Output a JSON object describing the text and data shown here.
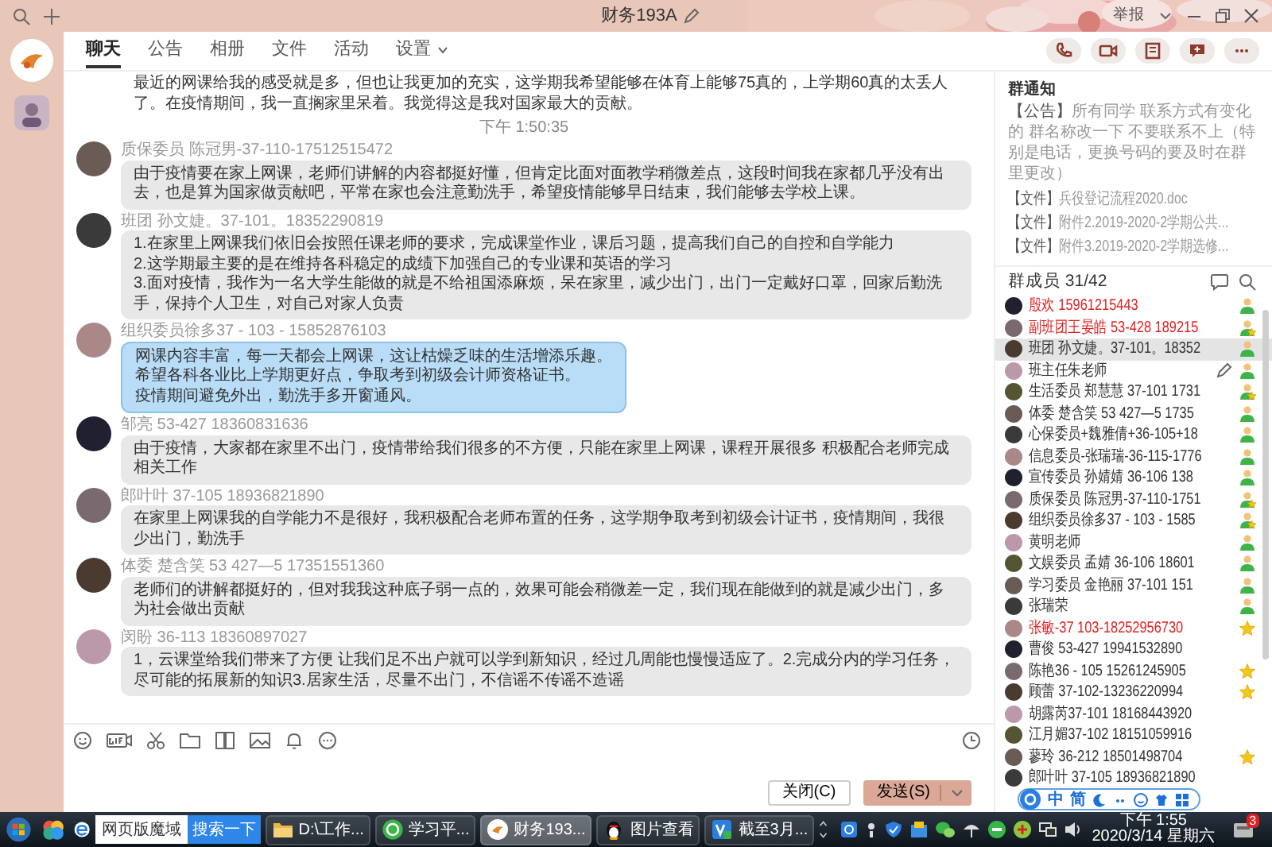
{
  "window": {
    "title": "财务193A",
    "report": "举报"
  },
  "tabs": [
    {
      "label": "聊天",
      "selected": true,
      "dropdown": false
    },
    {
      "label": "公告",
      "selected": false,
      "dropdown": false
    },
    {
      "label": "相册",
      "selected": false,
      "dropdown": false
    },
    {
      "label": "文件",
      "selected": false,
      "dropdown": false
    },
    {
      "label": "活动",
      "selected": false,
      "dropdown": false
    },
    {
      "label": "设置",
      "selected": false,
      "dropdown": true
    }
  ],
  "messages": [
    {
      "kind": "plain",
      "lines": [
        "最近的网课给我的感受就是多，但也让我更加的充实，这学期我希望能够在体育上能够75真的，上学期60真的太丢人了。在疫情期间，我一直搁家里呆着。我觉得这是我对国家最大的贡献。"
      ]
    },
    {
      "kind": "time",
      "text": "下午 1:50:35"
    },
    {
      "kind": "gray",
      "sender": "质保委员 陈冠男-37-110-17512515472",
      "lines": [
        "由于疫情要在家上网课，老师们讲解的内容都挺好懂，但肯定比面对面教学稍微差点，这段时间我在家都几乎没有出去，也是算为国家做贡献吧，平常在家也会注意勤洗手，希望疫情能够早日结束，我们能够去学校上课。"
      ]
    },
    {
      "kind": "gray",
      "sender": "班团 孙文婕。37-101。18352290819",
      "lines": [
        "1.在家里上网课我们依旧会按照任课老师的要求，完成课堂作业，课后习题，提高我们自己的自控和自学能力",
        "2.这学期最主要的是在维持各科稳定的成绩下加强自己的专业课和英语的学习",
        "3.面对疫情，我作为一名大学生能做的就是不给祖国添麻烦，呆在家里，减少出门，出门一定戴好口罩，回家后勤洗手，保持个人卫生，对自己对家人负责"
      ]
    },
    {
      "kind": "blue",
      "sender": "组织委员徐多37 - 103 - 15852876103",
      "lines": [
        "网课内容丰富，每一天都会上网课，这让枯燥乏味的生活增添乐趣。",
        "希望各科各业比上学期更好点，争取考到初级会计师资格证书。",
        "疫情期间避免外出，勤洗手多开窗通风。"
      ]
    },
    {
      "kind": "gray",
      "sender": "邹亮 53-427 18360831636",
      "lines": [
        "由于疫情，大家都在家里不出门，疫情带给我们很多的不方便，只能在家里上网课，课程开展很多 积极配合老师完成相关工作"
      ]
    },
    {
      "kind": "gray",
      "sender": "郎叶叶 37-105 18936821890",
      "lines": [
        "在家里上网课我的自学能力不是很好，我积极配合老师布置的任务，这学期争取考到初级会计证书，疫情期间，我很少出门，勤洗手"
      ]
    },
    {
      "kind": "gray",
      "sender": "体委 楚含笑 53 427—5 17351551360",
      "lines": [
        "老师们的讲解都挺好的，但对我我这种底子弱一点的，效果可能会稍微差一定，我们现在能做到的就是减少出门，多为社会做出贡献"
      ]
    },
    {
      "kind": "gray",
      "sender": "闵盼 36-113 18360897027",
      "lines": [
        "1，云课堂给我们带来了方便 让我们足不出户就可以学到新知识，经过几周能也慢慢适应了。2.完成分内的学习任务，尽可能的拓展新的知识3.居家生活，尽量不出门，不信谣不传谣不造谣"
      ]
    }
  ],
  "composer": {
    "close_button": "关闭(C)",
    "send_button": "发送(S)"
  },
  "notice": {
    "title": "群通知",
    "tag": "【公告】",
    "text": "所有同学 联系方式有变化的 群名称改一下 不要联系不上（特别是电话，更换号码的要及时在群里更改）",
    "files": [
      {
        "tag": "【文件】",
        "name": "兵役登记流程2020.doc"
      },
      {
        "tag": "【文件】",
        "name": "附件2.2019-2020-2学期公共..."
      },
      {
        "tag": "【文件】",
        "name": "附件3.2019-2020-2学期选修..."
      }
    ]
  },
  "members": {
    "title": "群成员 31/42",
    "items": [
      {
        "name": "殷欢 15961215443",
        "color": "#e02020",
        "selected": false,
        "kind": "member",
        "edit": false
      },
      {
        "name": "副班团王晏皓 53-428 189215",
        "color": "#e02020",
        "selected": false,
        "kind": "admin",
        "edit": false
      },
      {
        "name": "班团 孙文婕。37-101。18352",
        "color": "#333333",
        "selected": true,
        "kind": "member",
        "edit": false
      },
      {
        "name": "班主任朱老师",
        "color": "#333333",
        "selected": false,
        "kind": "member",
        "edit": true
      },
      {
        "name": "生活委员 郑慧慧 37-101 1731",
        "color": "#333333",
        "selected": false,
        "kind": "admin",
        "edit": false
      },
      {
        "name": "体委 楚含笑 53 427—5 1735",
        "color": "#333333",
        "selected": false,
        "kind": "member",
        "edit": false
      },
      {
        "name": "心保委员+魏雅倩+36-105+18",
        "color": "#333333",
        "selected": false,
        "kind": "member",
        "edit": false
      },
      {
        "name": "信息委员-张瑞瑞-36-115-1776",
        "color": "#333333",
        "selected": false,
        "kind": "member",
        "edit": false
      },
      {
        "name": "宣传委员 孙婧婧 36-106 138",
        "color": "#333333",
        "selected": false,
        "kind": "member",
        "edit": false
      },
      {
        "name": "质保委员 陈冠男-37-110-1751",
        "color": "#333333",
        "selected": false,
        "kind": "admin",
        "edit": false
      },
      {
        "name": "组织委员徐多37 - 103 - 1585",
        "color": "#333333",
        "selected": false,
        "kind": "admin",
        "edit": false
      },
      {
        "name": "黄明老师",
        "color": "#333333",
        "selected": false,
        "kind": "member",
        "edit": false
      },
      {
        "name": "文娱委员 孟婧 36-106 18601",
        "color": "#333333",
        "selected": false,
        "kind": "member",
        "edit": false
      },
      {
        "name": "学习委员 金艳丽 37-101 151",
        "color": "#333333",
        "selected": false,
        "kind": "member",
        "edit": false
      },
      {
        "name": "张瑞荣",
        "color": "#333333",
        "selected": false,
        "kind": "member",
        "edit": false
      },
      {
        "name": "张敏-37 103-18252956730",
        "color": "#e02020",
        "selected": false,
        "kind": "star",
        "edit": false
      },
      {
        "name": "曹俊 53-427 19941532890",
        "color": "#333333",
        "selected": false,
        "kind": "none",
        "edit": false
      },
      {
        "name": "陈艳36 - 105 15261245905",
        "color": "#333333",
        "selected": false,
        "kind": "star",
        "edit": false
      },
      {
        "name": "顾蕾 37-102-13236220994",
        "color": "#333333",
        "selected": false,
        "kind": "star",
        "edit": false
      },
      {
        "name": "胡露芮37-101 18168443920",
        "color": "#333333",
        "selected": false,
        "kind": "none",
        "edit": false
      },
      {
        "name": "江月媚37-102 18151059916",
        "color": "#333333",
        "selected": false,
        "kind": "none",
        "edit": false
      },
      {
        "name": "蓼玲 36-212 18501498704",
        "color": "#333333",
        "selected": false,
        "kind": "star",
        "edit": false
      },
      {
        "name": "郎叶叶 37-105 18936821890",
        "color": "#333333",
        "selected": false,
        "kind": "none",
        "edit": false
      }
    ]
  },
  "ime": {
    "mode": "中",
    "charset": "简"
  },
  "taskbar": {
    "search_value": "网页版魔域",
    "search_button": "搜索一下",
    "tasks": [
      {
        "label": "D:\\工作...",
        "active": false
      },
      {
        "label": "学习平...",
        "active": false
      },
      {
        "label": "财务193...",
        "active": true
      },
      {
        "label": "图片查看",
        "active": false
      },
      {
        "label": "截至3月...",
        "active": false
      }
    ],
    "clock_time": "下午 1:55",
    "clock_date": "2020/3/14 星期六",
    "notification_count": "3"
  }
}
